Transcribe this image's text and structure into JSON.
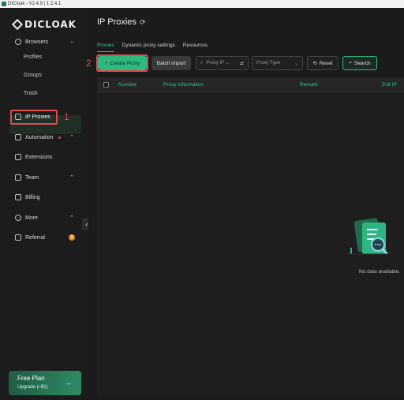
{
  "window": {
    "title": "DICloak - V2.4.9 | 1.2.4.1"
  },
  "brand": {
    "name": "DICLOAK"
  },
  "sidebar": {
    "browsers": {
      "label": "Browsers",
      "chevron": "⌄"
    },
    "sub_items": [
      "Profiles",
      "Groups",
      "Trash"
    ],
    "ip_proxies": {
      "label": "IP Proxies"
    },
    "automation": {
      "label": "Automation",
      "chevron": "⌃"
    },
    "extensions": {
      "label": "Extensions"
    },
    "team": {
      "label": "Team",
      "chevron": "⌃"
    },
    "billing": {
      "label": "Billing"
    },
    "more": {
      "label": "More",
      "chevron": "⌃"
    },
    "referral": {
      "label": "Referral",
      "badge": "$"
    },
    "collapse": "‹"
  },
  "plan": {
    "title": "Free Plan",
    "subtitle": "Upgrade (≈$1)",
    "arrow": "→"
  },
  "annotations": {
    "step1": "1",
    "step2": "2",
    "color": "#e24b4b"
  },
  "main": {
    "title": "IP Proxies",
    "refresh_glyph": "⟳",
    "tabs": [
      "Proxies",
      "Dynamic proxy settings",
      "Resources"
    ],
    "toolbar": {
      "create_icon": "+",
      "create_label": "Create Proxy",
      "batch_label": "Batch import",
      "search_icon": "⌕",
      "search_placeholder": "Proxy IP ...",
      "filter_icon": "⇄",
      "type_placeholder": "Proxy Type",
      "type_chevron": "⌄",
      "reset_icon": "⟲",
      "reset_label": "Reset",
      "search_button_icon": "⌕",
      "search_button_label": "Search"
    },
    "table": {
      "columns": [
        "Number",
        "Proxy Information",
        "Remark",
        "Exit IP"
      ],
      "empty_text": "No data available."
    }
  },
  "colors": {
    "accent": "#29c78b",
    "button_green": "#2db97f",
    "background": "#1b1b1b"
  }
}
